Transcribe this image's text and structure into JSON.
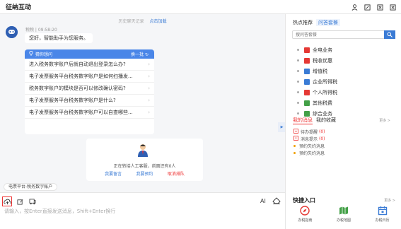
{
  "app": {
    "title": "征纳互动"
  },
  "chat": {
    "history_label": "历史聊天记录",
    "history_link": "点击加载",
    "bot_meta": "税税 | 09:58:20",
    "greeting": "您好，智能助手为您服务。",
    "guess": {
      "title": "猜你想问",
      "refresh_label": "换一批",
      "questions": [
        "进入税务数字账户后就自动退出登录怎么办?",
        "电子发票服务平台税务数字账户是如何扫播发...",
        "税务数字账户的模块是否可以修改确认密码?",
        "电子发票服务平台税务数字账户是什么?",
        "电子发票服务平台税务数字账户可以自查哪些..."
      ]
    },
    "agent": {
      "status": "正在转接人工客服，前面还有0人",
      "links": [
        "我要留言",
        "我要预约",
        "取消排队"
      ]
    },
    "context_tag": "电票平台-税务数字账户"
  },
  "input": {
    "ai_label": "AI",
    "placeholder": "请输入，按Enter直接发送消息，Shift+Enter换行"
  },
  "sidebar": {
    "tabs": [
      "热点推荐",
      "问答套餐"
    ],
    "search_placeholder": "搜问答套餐",
    "topics": [
      {
        "label": "全电业务",
        "color": "#e53935"
      },
      {
        "label": "税收优惠",
        "color": "#e53935"
      },
      {
        "label": "增值税",
        "color": "#3a7bd5"
      },
      {
        "label": "企业所得税",
        "color": "#3a7bd5"
      },
      {
        "label": "个人所得税",
        "color": "#e53935"
      },
      {
        "label": "其他税费",
        "color": "#43a047"
      },
      {
        "label": "综合业务",
        "color": "#43a047"
      }
    ],
    "msg_tabs": [
      "我的消息",
      "我的收藏"
    ],
    "more_label": "更多 >",
    "messages": [
      {
        "label": "待办提醒",
        "count": "(0)"
      },
      {
        "label": "消息提示",
        "count": "(0)"
      },
      {
        "label": "预约失约消息",
        "count": ""
      },
      {
        "label": "预约失约消息",
        "count": ""
      }
    ],
    "quick_title": "快捷入口",
    "quick_more": "更多 >",
    "quick_items": [
      "办税指南",
      "办税地图",
      "办税日历"
    ]
  },
  "colors": {
    "accent": "#3a7bd5",
    "alert": "#e53935"
  }
}
